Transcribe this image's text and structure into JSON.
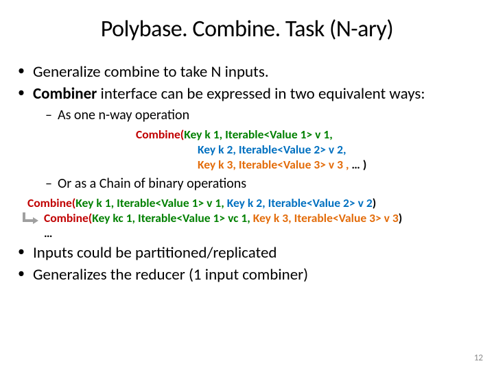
{
  "title": "Polybase. Combine. Task (N-ary)",
  "bullets": {
    "b1": "Generalize combine to take N inputs.",
    "b2_pre": "Combiner",
    "b2_post": " interface can be expressed in two equivalent ways:",
    "b3": "Inputs could be partitioned/replicated",
    "b4": "Generalizes the reducer (1 input combiner)"
  },
  "sub": {
    "s1": "As one n-way operation",
    "s2": "Or as a Chain of binary operations"
  },
  "nway": {
    "l1": {
      "combine": "Combine(",
      "key": "Key k 1, ",
      "iter": "Iterable<Value 1> v 1,",
      "tail": ""
    },
    "l2": {
      "key": "Key k 2, ",
      "iter": "Iterable<Value 2> v 2,",
      "tail": ""
    },
    "l3": {
      "key": "Key k 3, ",
      "iter": "Iterable<Value 3> v 3 ,",
      "tail": " … )"
    }
  },
  "chain": {
    "l1": {
      "combine": "Combine(",
      "key1": "Key k 1, ",
      "iter1": "Iterable<Value 1> v 1, ",
      "key2": "Key k 2, ",
      "iter2": "Iterable<Value 2> v 2",
      "tail": ")"
    },
    "l2": {
      "combine": "Combine(",
      "key1": "Key kc 1, ",
      "iter1": "Iterable<Value 1> vc 1, ",
      "key2": "Key k 3, ",
      "iter2": "Iterable<Value 3> v 3",
      "tail": ")"
    },
    "ellipsis": "…"
  },
  "pagenum": "12"
}
